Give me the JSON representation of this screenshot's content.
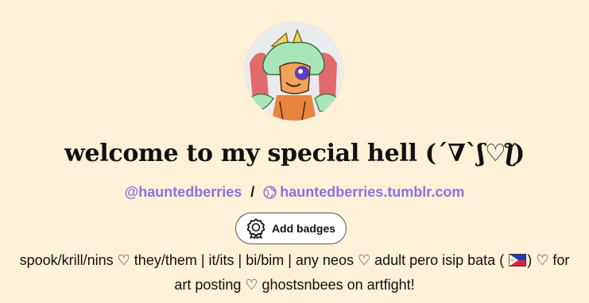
{
  "profile": {
    "title": "welcome to my special hell (´∇`ʃ♡ƪ)",
    "handle": "@hauntedberries",
    "separator": "/",
    "blog_url": "hauntedberries.tumblr.com",
    "badges_button": "Add badges",
    "bio_part1": "spook/krill/nins ♡ they/them | it/its | bi/bim | any neos ♡ adult pero isip bata (",
    "bio_part2": ") ♡ for art posting ♡ ghostsnbees on artfight!"
  },
  "icons": {
    "globe": "globe-icon",
    "badge": "badge-rosette-icon",
    "flag": "philippines-flag-icon"
  },
  "colors": {
    "background": "#fdf1d8",
    "link": "#8a73de",
    "text": "#111111",
    "button_bg": "#ffffff"
  }
}
